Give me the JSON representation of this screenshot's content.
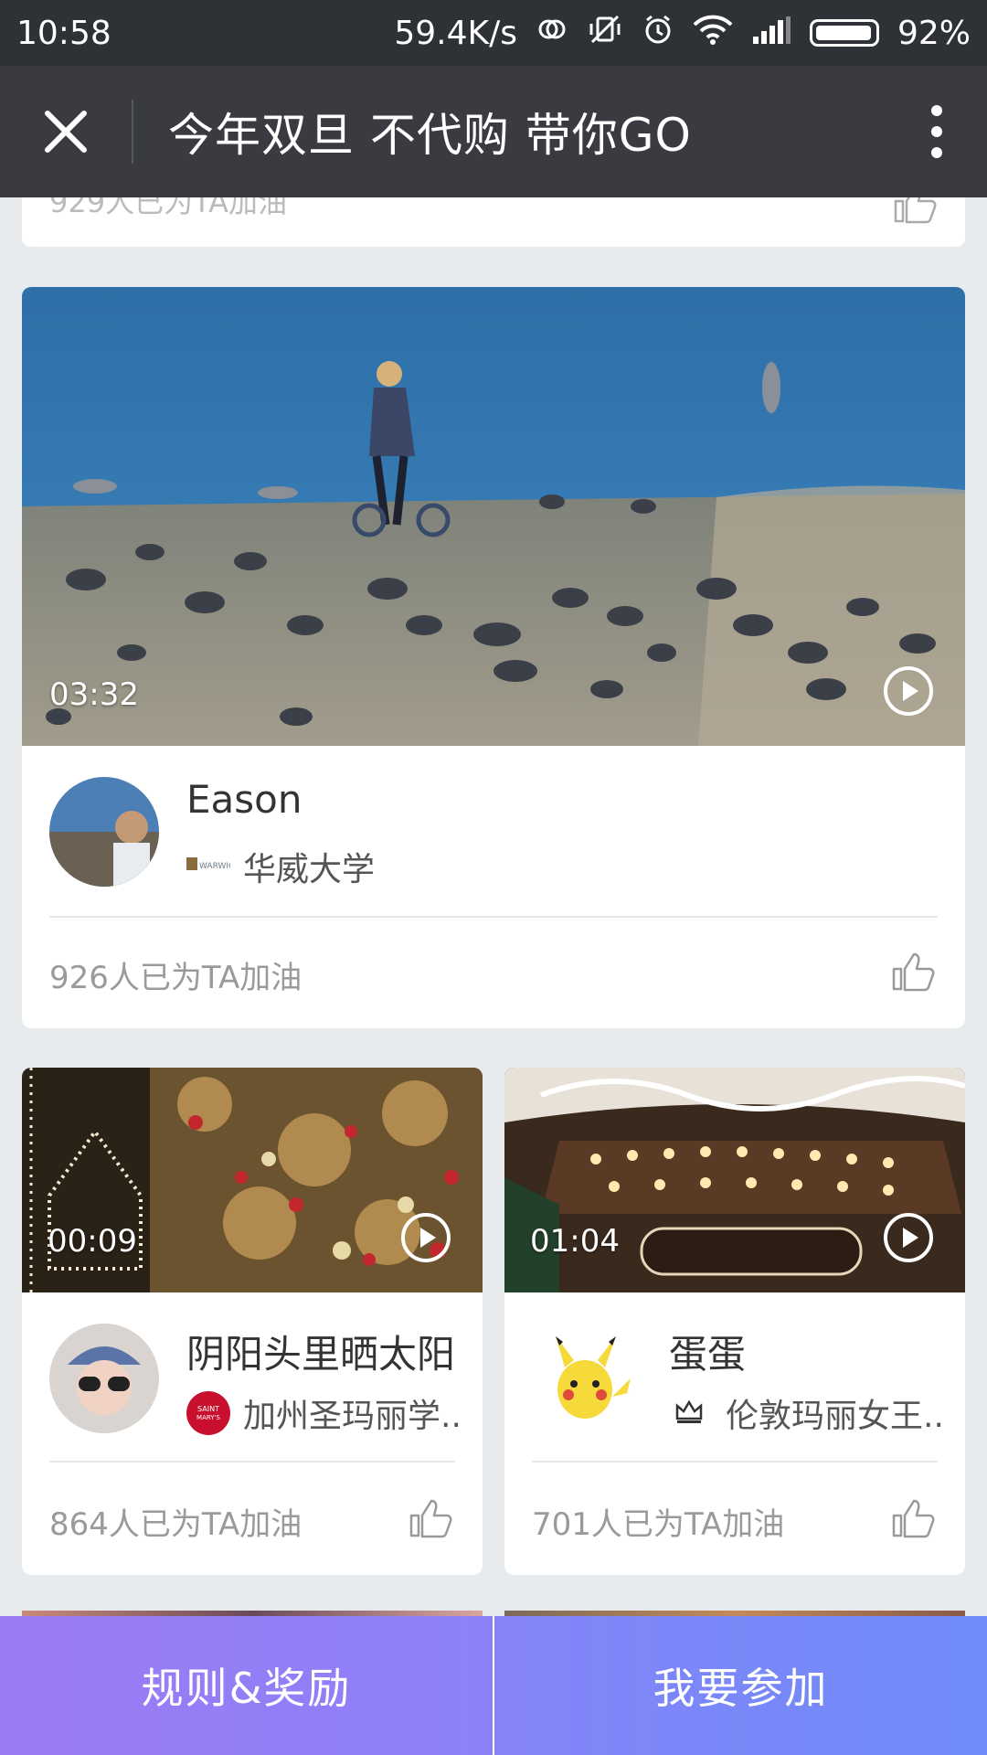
{
  "status_bar": {
    "time": "10:58",
    "network_speed": "59.4K/s",
    "battery": "92%"
  },
  "nav": {
    "title": "今年双旦 不代购 带你GO",
    "close_icon": "close-icon",
    "more_icon": "more-vertical-icon"
  },
  "partial_card": {
    "cheer": "929人已为TA加油"
  },
  "cards": [
    {
      "duration": "03:32",
      "name": "Eason",
      "school": "华威大学",
      "cheer": "926人已为TA加油"
    },
    {
      "duration": "00:09",
      "name": "阴阳头里晒太阳",
      "school": "加州圣玛丽学..",
      "cheer": "864人已为TA加油"
    },
    {
      "duration": "01:04",
      "name": "蛋蛋",
      "school": "伦敦玛丽女王..",
      "cheer": "701人已为TA加油"
    }
  ],
  "bottom_bar": {
    "rules_label": "规则&奖励",
    "join_label": "我要参加"
  },
  "colors": {
    "status_bar_bg": "#2e3135",
    "nav_bg": "#393b40",
    "page_bg": "#e7ebee",
    "button_gradient_start": "#9c7af5",
    "button_gradient_end": "#6e8cf9"
  }
}
